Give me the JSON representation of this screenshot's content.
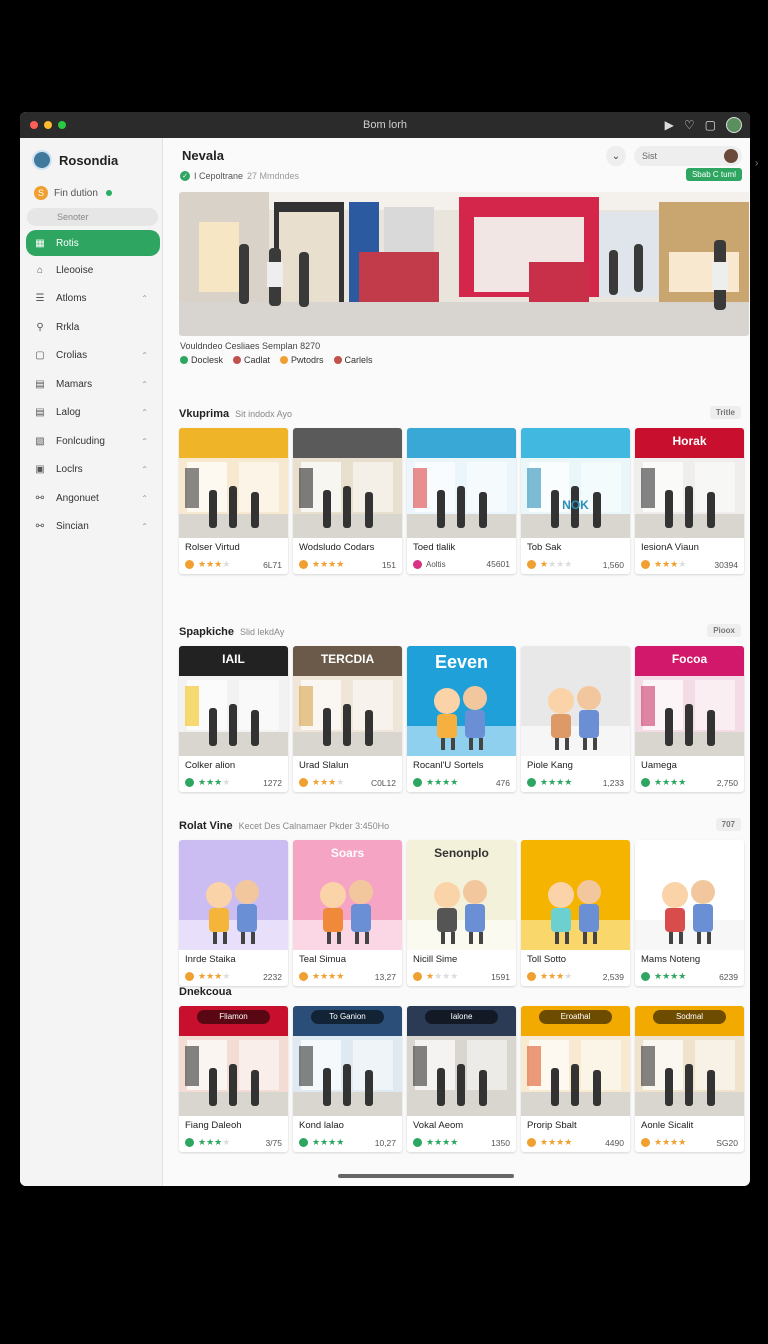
{
  "window": {
    "title": "Bom lorh"
  },
  "sidebar": {
    "brand": "Rosondia",
    "status": "Fin dution",
    "search_placeholder": "Senoter",
    "items": [
      {
        "label": "Rotis",
        "icon": "grid-icon",
        "active": true
      },
      {
        "label": "Lleooise",
        "icon": "home-icon"
      },
      {
        "label": "Atloms",
        "icon": "list-icon"
      },
      {
        "label": "Rrkla",
        "icon": "search-icon"
      },
      {
        "label": "Crolias",
        "icon": "square-icon"
      },
      {
        "label": "Mamars",
        "icon": "doc-icon"
      },
      {
        "label": "Lalog",
        "icon": "doc-icon"
      },
      {
        "label": "Fonlcuding",
        "icon": "bag-icon"
      },
      {
        "label": "Loclrs",
        "icon": "calendar-icon"
      },
      {
        "label": "Angonuet",
        "icon": "tag-icon"
      },
      {
        "label": "Sincian",
        "icon": "tag-icon"
      }
    ]
  },
  "main": {
    "title": "Nevala",
    "search_placeholder": "Sist",
    "subhead": "I Cepoltrane",
    "subhead_extra": "27 Mmdndes",
    "pill": "Sbab C tuml",
    "hero_caption": "Vouldndeo Cesliaes Semplan 8270",
    "hero_legend": [
      {
        "label": "Doclesk",
        "color": "#2ea661"
      },
      {
        "label": "Cadlat",
        "color": "#c0524a"
      },
      {
        "label": "Pwtodrs",
        "color": "#f0a030"
      },
      {
        "label": "Carlels",
        "color": "#c0524a"
      }
    ]
  },
  "sections": [
    {
      "title": "Vkuprima",
      "sub": "Sit indodx Ayo",
      "badge": "Tritle",
      "cards": [
        {
          "name": "Rolser Virtud",
          "value": "6L71",
          "rating": 3,
          "ic": "#f0a030"
        },
        {
          "name": "Wodsludo Codars",
          "value": "151",
          "rating": 4,
          "ic": "#f0a030"
        },
        {
          "name": "Toed tlalik",
          "value": "45601",
          "rating": 0,
          "ic": "#d63384",
          "label": "Aoltis"
        },
        {
          "name": "Tob Sak",
          "value": "1,560",
          "rating": 1,
          "ic": "#f0a030"
        },
        {
          "name": "IesionA Viaun",
          "value": "30394",
          "rating": 3,
          "ic": "#f0a030"
        }
      ]
    },
    {
      "title": "Spapkiche",
      "sub": "Slid lekdAy",
      "badge": "Pioox",
      "cards": [
        {
          "name": "Colker alion",
          "value": "1272",
          "rating": 3,
          "ic": "#2ea661"
        },
        {
          "name": "Urad Slalun",
          "value": "C0L12",
          "rating": 3,
          "ic": "#f0a030"
        },
        {
          "name": "Rocanl'U Sortels",
          "value": "476",
          "rating": 4,
          "ic": "#2ea661"
        },
        {
          "name": "Piole Kang",
          "value": "1,233",
          "rating": 4,
          "ic": "#2ea661"
        },
        {
          "name": "Uamega",
          "value": "2,750",
          "rating": 4,
          "ic": "#2ea661"
        }
      ]
    },
    {
      "title": "Rolat Vine",
      "sub": "Kecet Des Calnamaer Pkder 3:450Ho",
      "badge": "707",
      "cards": [
        {
          "name": "Inrde Staika",
          "value": "2232",
          "rating": 3,
          "ic": "#f0a030"
        },
        {
          "name": "Teal Simua",
          "value": "13,27",
          "rating": 4,
          "ic": "#f0a030"
        },
        {
          "name": "Nicill Sime",
          "value": "1591",
          "rating": 1,
          "ic": "#f0a030"
        },
        {
          "name": "Toll Sotto",
          "value": "2,539",
          "rating": 3,
          "ic": "#f0a030"
        },
        {
          "name": "Mams Noteng",
          "value": "6239",
          "rating": 4,
          "ic": "#2ea661"
        }
      ]
    },
    {
      "title": "Dnekcoua",
      "sub": "",
      "badge": "",
      "cards": [
        {
          "name": "Fiang Daleoh",
          "value": "3/75",
          "rating": 3,
          "ic": "#2ea661",
          "banner": "Fliamon"
        },
        {
          "name": "Kond lalao",
          "value": "10,27",
          "rating": 4,
          "ic": "#2ea661",
          "banner": "To Ganion"
        },
        {
          "name": "Vokal Aeom",
          "value": "1350",
          "rating": 4,
          "ic": "#2ea661",
          "banner": "Ialone"
        },
        {
          "name": "Prorip Sbalt",
          "value": "4490",
          "rating": 4,
          "ic": "#f0a030",
          "banner": "Eroathal"
        },
        {
          "name": "Aonle Sicalit",
          "value": "SG20",
          "rating": 4,
          "ic": "#f0a030",
          "banner": "Sodmal"
        }
      ]
    }
  ],
  "thumb_texts": {
    "s2c1": "IAIL",
    "s2c2": "TERCDIA",
    "s2c3": "Eeven",
    "s2c5": "Focoa",
    "s3c2": "Soars",
    "s3c3": "Senonplo",
    "s1c4": "NOK",
    "s1c5": "Horak"
  }
}
